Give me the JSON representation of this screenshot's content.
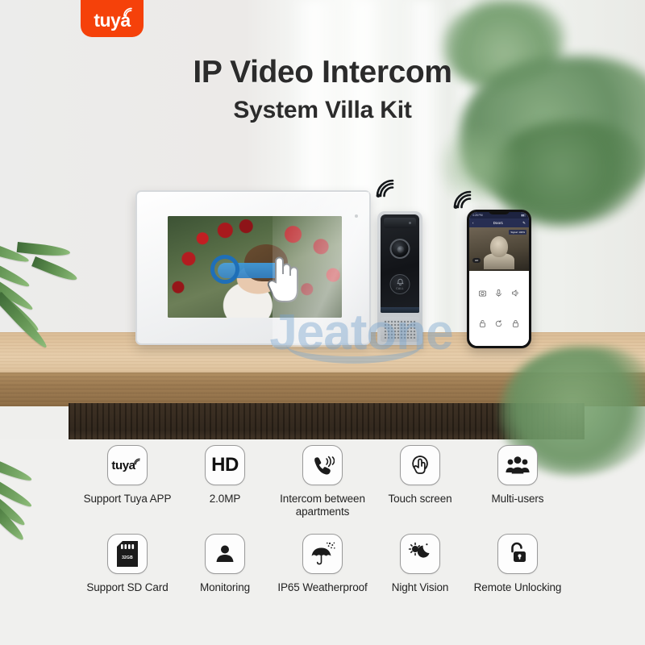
{
  "brand": {
    "logo_text": "tuya",
    "logo_bg": "#f5410a",
    "logo_icon": "wifi-icon"
  },
  "heading": {
    "title": "IP Video Intercom",
    "subtitle": "System Villa Kit"
  },
  "watermark": {
    "text": "Jeatone",
    "color": "#74a3ce"
  },
  "devices": {
    "monitor": {
      "name": "indoor-monitor",
      "screen_content": "woman-among-red-flowers-photo",
      "overlay": "unlock-slider",
      "cursor": "hand-pointer-icon"
    },
    "door_station": {
      "name": "outdoor-door-station",
      "lens": "camera-lens-icon",
      "call_button_label": "CALL",
      "speaker": "speaker-grille"
    },
    "phone": {
      "name": "smartphone-app",
      "status_time": "4:28 PM",
      "header_title": "Door1",
      "badge_label": "Signal: 100%",
      "chip_label": "HD",
      "controls": [
        "snapshot-icon",
        "microphone-icon",
        "speaker-icon",
        "unlock-icon",
        "refresh-icon",
        "lock-icon"
      ]
    },
    "wifi_marks": [
      "wifi-icon",
      "wifi-icon"
    ]
  },
  "features": {
    "row1": [
      {
        "icon": "tuya-logo-icon",
        "icon_text": "tuya",
        "label": "Support Tuya APP"
      },
      {
        "icon": "hd-icon",
        "icon_text": "HD",
        "label": "2.0MP"
      },
      {
        "icon": "phone-call-icon",
        "icon_text": "",
        "label": "Intercom between apartments"
      },
      {
        "icon": "touch-screen-icon",
        "icon_text": "",
        "label": "Touch screen"
      },
      {
        "icon": "multi-users-icon",
        "icon_text": "",
        "label": "Multi-users"
      }
    ],
    "row2": [
      {
        "icon": "sd-card-icon",
        "icon_text": "32GB",
        "label": "Support SD Card"
      },
      {
        "icon": "person-monitor-icon",
        "icon_text": "",
        "label": "Monitoring"
      },
      {
        "icon": "umbrella-rain-icon",
        "icon_text": "",
        "label": "IP65 Weatherproof"
      },
      {
        "icon": "sun-moon-icon",
        "icon_text": "",
        "label": "Night Vision"
      },
      {
        "icon": "unlock-padlock-icon",
        "icon_text": "",
        "label": "Remote Unlocking"
      }
    ]
  }
}
